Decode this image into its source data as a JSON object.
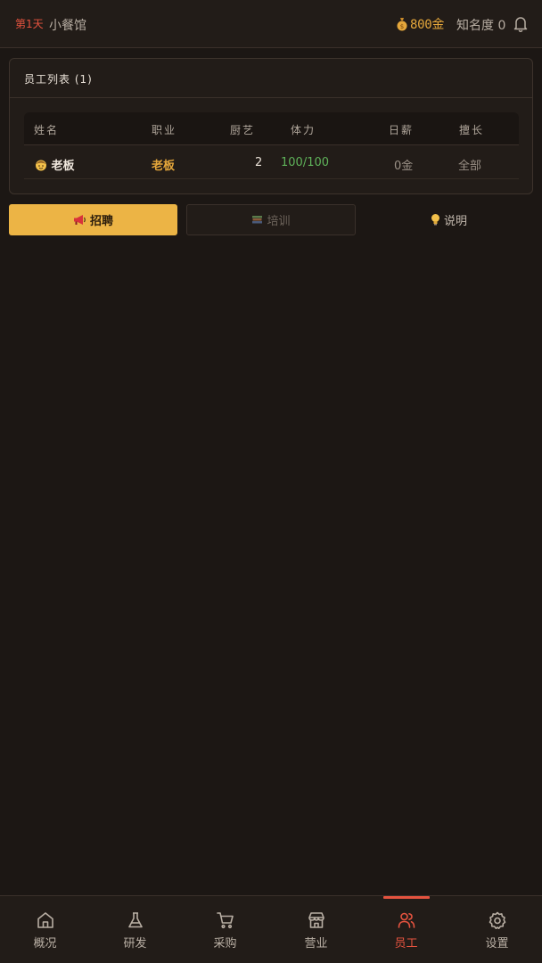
{
  "header": {
    "day": "第1天",
    "shop_name": "小餐馆",
    "gold": "800金",
    "fame": "知名度 0",
    "coin_icon": "money-bag-icon",
    "bell_icon": "bell-icon"
  },
  "staff_panel": {
    "title": "员工列表 (1)",
    "columns": [
      "姓名",
      "职业",
      "厨艺",
      "体力",
      "日薪",
      "擅长"
    ],
    "rows": [
      {
        "avatar_icon": "face-emoji-icon",
        "name": "老板",
        "job": "老板",
        "skill": "2",
        "stamina": "100/100",
        "salary": "0金",
        "specialty": "全部"
      }
    ]
  },
  "actions": {
    "recruit": {
      "icon": "megaphone-icon",
      "label": "招聘"
    },
    "train": {
      "icon": "books-icon",
      "label": "培训"
    },
    "info": {
      "icon": "lightbulb-icon",
      "label": "说明"
    }
  },
  "bottom_nav": {
    "active_index": 4,
    "items": [
      {
        "icon": "home-icon",
        "label": "概况"
      },
      {
        "icon": "flask-icon",
        "label": "研发"
      },
      {
        "icon": "cart-icon",
        "label": "采购"
      },
      {
        "icon": "store-icon",
        "label": "营业"
      },
      {
        "icon": "users-icon",
        "label": "员工"
      },
      {
        "icon": "gear-icon",
        "label": "设置"
      }
    ]
  },
  "colors": {
    "background": "#1c1714",
    "accent_red": "#e5533f",
    "gold": "#e5a73b",
    "recruit_button": "#ecb445",
    "stamina_green": "#5fb35a"
  }
}
